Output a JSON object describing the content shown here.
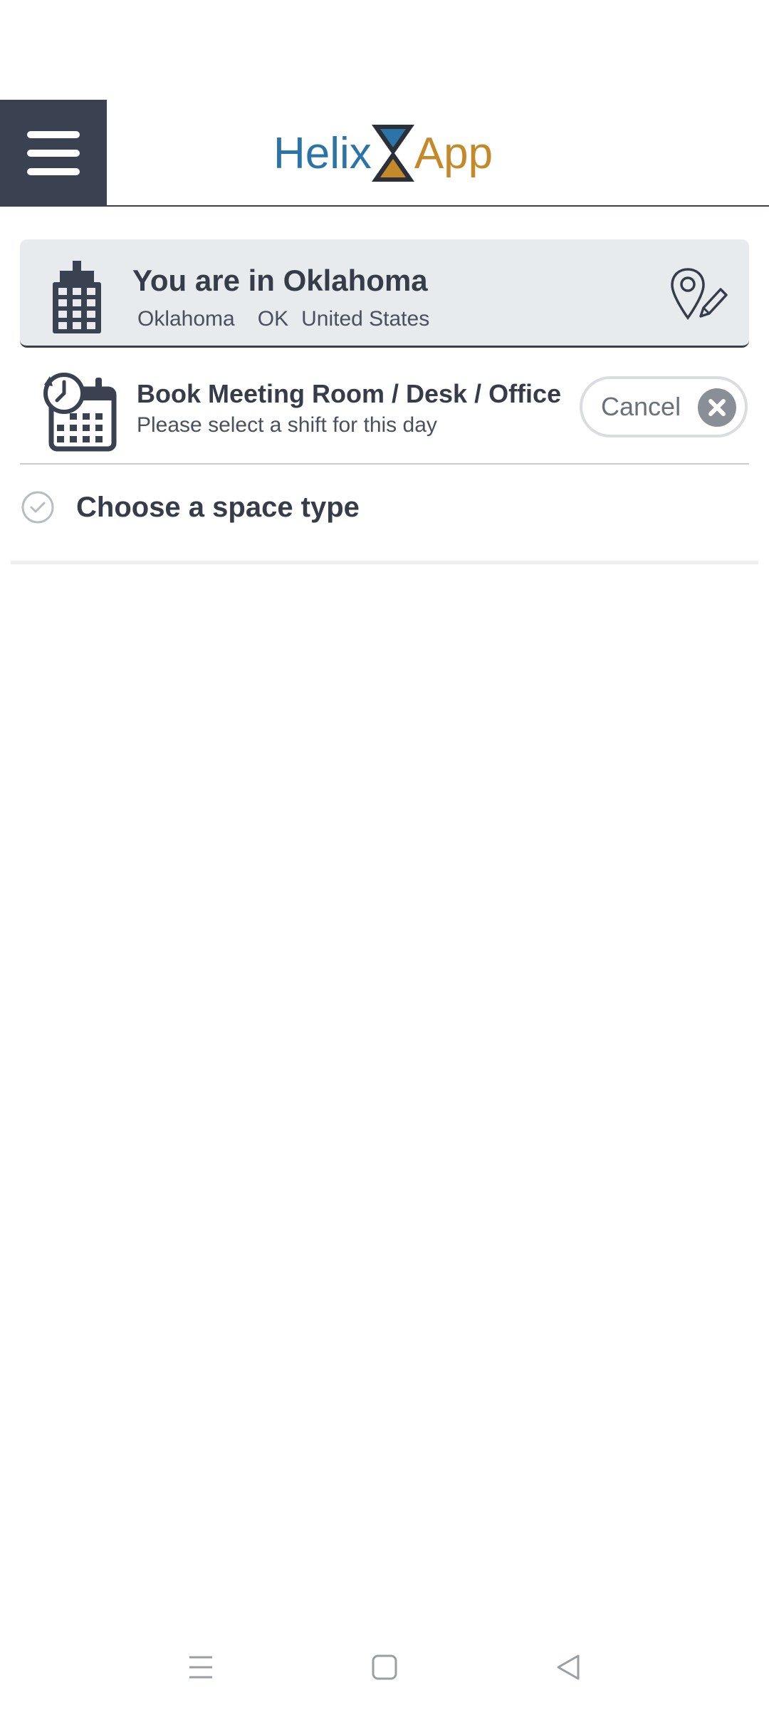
{
  "header": {
    "logo_left": "Helix",
    "logo_right": "App"
  },
  "location": {
    "title": "You are in Oklahoma",
    "city": "Oklahoma",
    "state": "OK",
    "country": "United States"
  },
  "booking": {
    "title": "Book Meeting Room / Desk / Office",
    "subtitle": "Please select a shift for this day",
    "cancel_label": "Cancel"
  },
  "space": {
    "label": "Choose a space type"
  },
  "colors": {
    "brand_dark": "#3a4150",
    "logo_blue": "#2a74a8",
    "logo_gold": "#c48a2a"
  },
  "icons": [
    "menu-icon",
    "building-icon",
    "location-edit-icon",
    "calendar-clock-icon",
    "close-icon",
    "check-circle-icon",
    "nav-recents-icon",
    "nav-home-icon",
    "nav-back-icon"
  ]
}
